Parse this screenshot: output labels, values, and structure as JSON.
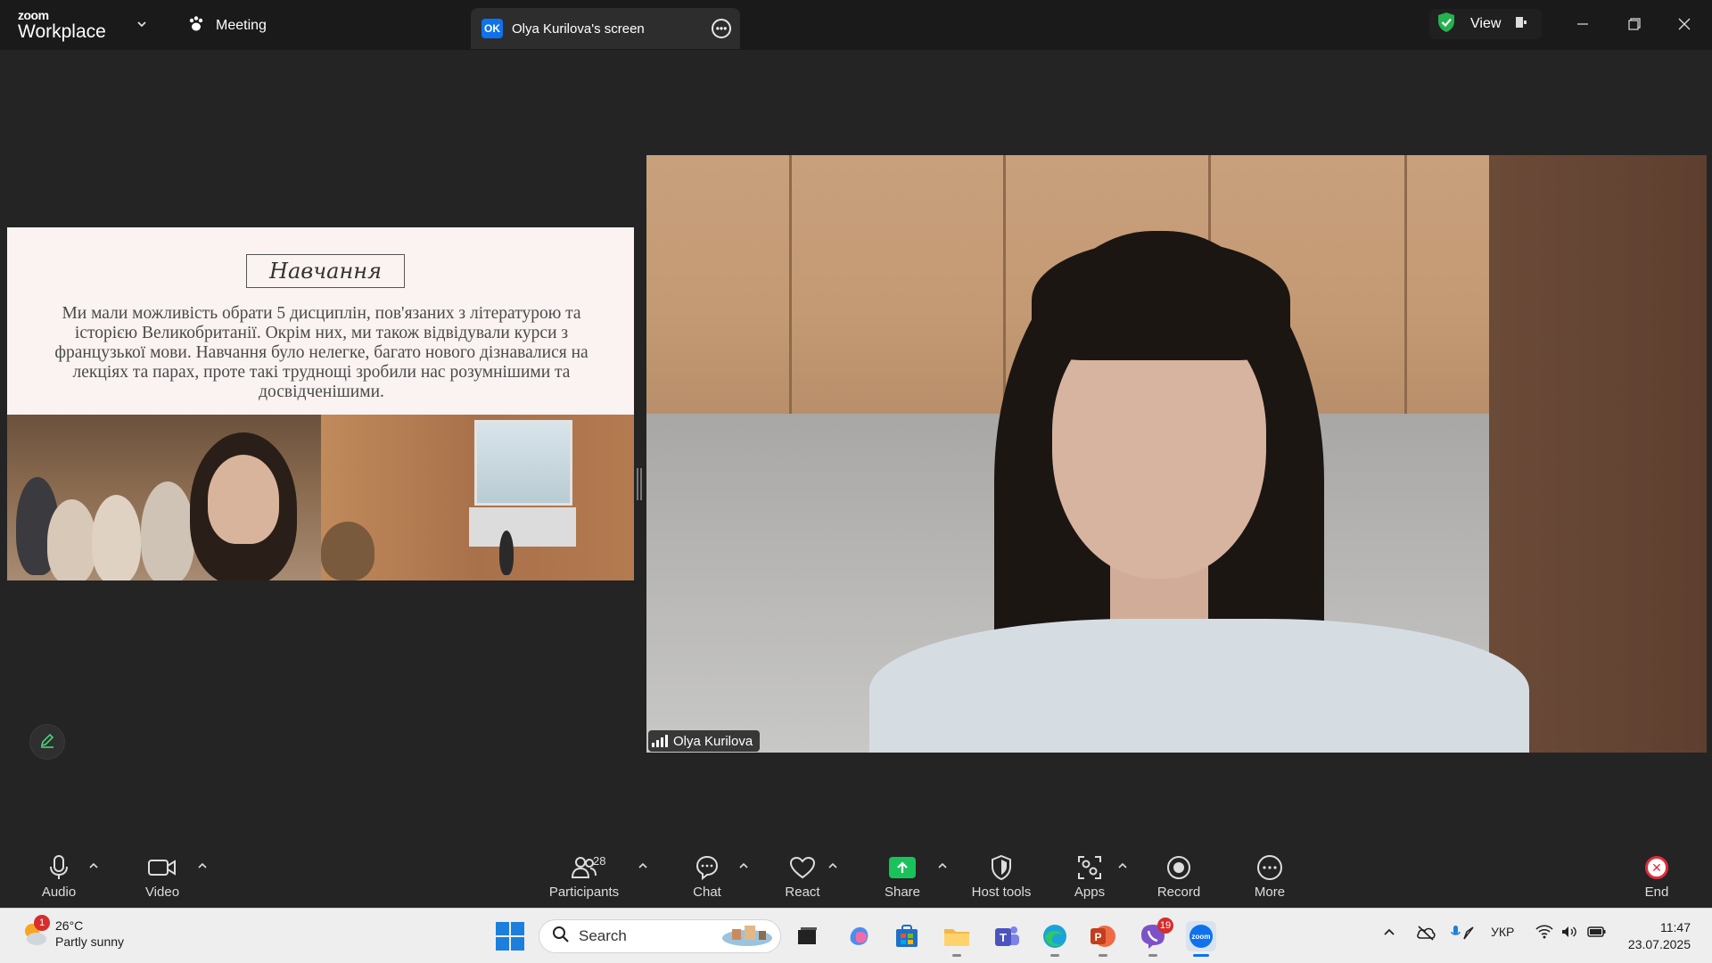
{
  "topbar": {
    "brand_small": "zoom",
    "brand_big": "Workplace",
    "meeting_tab": "Meeting",
    "screen_tab_badge": "OK",
    "screen_tab_label": "Olya Kurilova's screen",
    "view_label": "View"
  },
  "slide": {
    "title": "Навчання",
    "body": "Ми мали можливість обрати 5 дисциплін, пов'язаних з літературою та історією Великобританії. Окрім них, ми також відвідували курси з французької мови. Навчання було нелегке, багато нового дізнавалися на лекціях та парах, проте такі труднощі зробили нас розумнішими та досвідченішими."
  },
  "video": {
    "participant_name": "Olya Kurilova"
  },
  "toolbar": {
    "audio": "Audio",
    "video": "Video",
    "participants": "Participants",
    "participants_count": "28",
    "chat": "Chat",
    "react": "React",
    "share": "Share",
    "host_tools": "Host tools",
    "apps": "Apps",
    "record": "Record",
    "more": "More",
    "end": "End"
  },
  "taskbar": {
    "weather_badge": "1",
    "temperature": "26°C",
    "weather_desc": "Partly sunny",
    "search_placeholder": "Search",
    "viber_badge": "19",
    "language": "УКР",
    "time": "11:47",
    "date": "23.07.2025"
  },
  "colors": {
    "zoom_blue": "#0e72ed",
    "share_green": "#19c25b",
    "end_red": "#e02b3c"
  }
}
